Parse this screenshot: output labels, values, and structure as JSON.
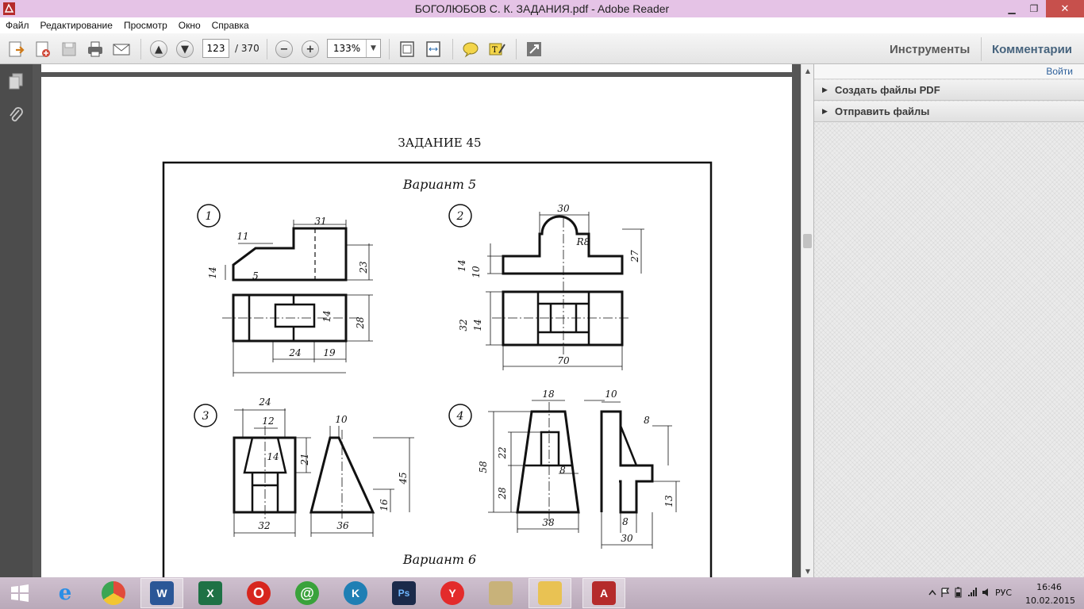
{
  "window": {
    "title": "БОГОЛЮБОВ С. К. ЗАДАНИЯ.pdf - Adobe Reader"
  },
  "menu": [
    "Файл",
    "Редактирование",
    "Просмотр",
    "Окно",
    "Справка"
  ],
  "toolbar": {
    "page_current": "123",
    "page_total": "/ 370",
    "zoom": "133%",
    "tools_label": "Инструменты",
    "comments_label": "Комментарии"
  },
  "rightpane": {
    "login": "Войти",
    "sections": [
      "Создать файлы PDF",
      "Отправить файлы"
    ]
  },
  "document": {
    "heading": "ЗАДАНИЕ 45",
    "variant_top": "Вариант 5",
    "variant_bottom": "Вариант 6",
    "figures": [
      {
        "num": "1",
        "dims": [
          "11",
          "31",
          "14",
          "5",
          "23",
          "28",
          "14",
          "24",
          "19"
        ]
      },
      {
        "num": "2",
        "dims": [
          "30",
          "R8",
          "14",
          "10",
          "27",
          "32",
          "14",
          "70"
        ]
      },
      {
        "num": "3",
        "dims": [
          "24",
          "12",
          "14",
          "21",
          "10",
          "45",
          "16",
          "32",
          "36"
        ]
      },
      {
        "num": "4",
        "dims": [
          "18",
          "10",
          "8",
          "22",
          "58",
          "28",
          "8",
          "13",
          "38",
          "8",
          "30"
        ]
      }
    ]
  },
  "taskbar": {
    "apps": [
      "internet-explorer",
      "chrome",
      "word",
      "excel",
      "opera",
      "mail-agent",
      "kaspersky",
      "photoshop",
      "yandex",
      "archive",
      "file-explorer",
      "adobe-reader"
    ],
    "lang": "РУС",
    "time": "16:46",
    "date": "10.02.2015"
  },
  "colors": {
    "titlebar": "#e5c3e6",
    "close": "#c7504c",
    "taskbar": "#c4b4c4",
    "link": "#2c5f9a"
  }
}
